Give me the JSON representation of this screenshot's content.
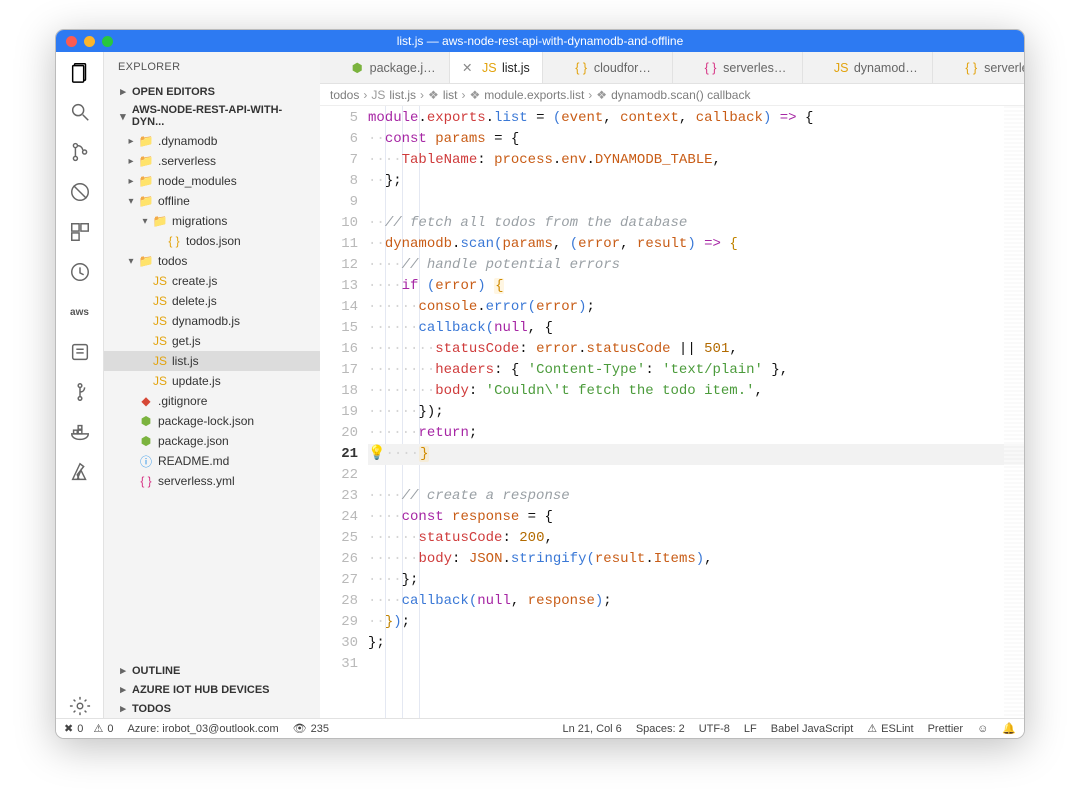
{
  "title": "list.js — aws-node-rest-api-with-dynamodb-and-offline",
  "explorer_label": "EXPLORER",
  "sections": {
    "open_editors": "OPEN EDITORS",
    "project": "AWS-NODE-REST-API-WITH-DYN...",
    "outline": "OUTLINE",
    "azure": "AZURE IOT HUB DEVICES",
    "todos": "TODOS"
  },
  "tree": [
    {
      "i": 0,
      "d": 1,
      "tw": "▸",
      "ic": "folder",
      "cls": "folder",
      "t": ".dynamodb"
    },
    {
      "i": 1,
      "d": 1,
      "tw": "▸",
      "ic": "folder",
      "cls": "folder",
      "t": ".serverless"
    },
    {
      "i": 2,
      "d": 1,
      "tw": "▸",
      "ic": "folder",
      "cls": "folder",
      "t": "node_modules"
    },
    {
      "i": 3,
      "d": 1,
      "tw": "▾",
      "ic": "folder",
      "cls": "fopen",
      "t": "offline"
    },
    {
      "i": 4,
      "d": 2,
      "tw": "▾",
      "ic": "folder",
      "cls": "fopen",
      "t": "migrations"
    },
    {
      "i": 5,
      "d": 3,
      "tw": "",
      "ic": "{ }",
      "cls": "jsonc",
      "t": "todos.json"
    },
    {
      "i": 6,
      "d": 1,
      "tw": "▾",
      "ic": "folder",
      "cls": "fopen",
      "t": "todos"
    },
    {
      "i": 7,
      "d": 2,
      "tw": "",
      "ic": "JS",
      "cls": "js",
      "t": "create.js"
    },
    {
      "i": 8,
      "d": 2,
      "tw": "",
      "ic": "JS",
      "cls": "js",
      "t": "delete.js"
    },
    {
      "i": 9,
      "d": 2,
      "tw": "",
      "ic": "JS",
      "cls": "js",
      "t": "dynamodb.js"
    },
    {
      "i": 10,
      "d": 2,
      "tw": "",
      "ic": "JS",
      "cls": "js",
      "t": "get.js"
    },
    {
      "i": 11,
      "d": 2,
      "tw": "",
      "ic": "JS",
      "cls": "js",
      "t": "list.js",
      "sel": true
    },
    {
      "i": 12,
      "d": 2,
      "tw": "",
      "ic": "JS",
      "cls": "js",
      "t": "update.js"
    },
    {
      "i": 13,
      "d": 1,
      "tw": "",
      "ic": "◆",
      "cls": "gitig",
      "t": ".gitignore"
    },
    {
      "i": 14,
      "d": 1,
      "tw": "",
      "ic": "⬢",
      "cls": "lock",
      "t": "package-lock.json"
    },
    {
      "i": 15,
      "d": 1,
      "tw": "",
      "ic": "⬢",
      "cls": "lock",
      "t": "package.json"
    },
    {
      "i": 16,
      "d": 1,
      "tw": "",
      "ic": "ⓘ",
      "cls": "info",
      "t": "README.md"
    },
    {
      "i": 17,
      "d": 1,
      "tw": "",
      "ic": "{ }",
      "cls": "yml",
      "t": "serverless.yml"
    }
  ],
  "tabs": [
    {
      "i": 0,
      "ic": "⬢",
      "cls": "lock",
      "t": "package.json"
    },
    {
      "i": 1,
      "ic": "JS",
      "cls": "js",
      "t": "list.js",
      "active": true
    },
    {
      "i": 2,
      "ic": "{ }",
      "cls": "jsonc",
      "t": "cloudformati"
    },
    {
      "i": 3,
      "ic": "{ }",
      "cls": "yml",
      "t": "serverless.yr"
    },
    {
      "i": 4,
      "ic": "JS",
      "cls": "js",
      "t": "dynamodb.js"
    },
    {
      "i": 5,
      "ic": "{ }",
      "cls": "jsonc",
      "t": "serverless-s"
    }
  ],
  "breadcrumb": [
    {
      "t": "todos",
      "ic": ""
    },
    {
      "t": "list.js",
      "ic": "JS"
    },
    {
      "t": "list",
      "ic": "❖"
    },
    {
      "t": "module.exports.list",
      "ic": "❖"
    },
    {
      "t": "dynamodb.scan() callback",
      "ic": "❖"
    }
  ],
  "code": {
    "first_line": 5,
    "active_line": 21,
    "lines": [
      {
        "n": 5,
        "h": "<span class='mtk-kw'>module</span><span class='mtk-op'>.</span><span class='mtk-prop'>exports</span><span class='mtk-op'>.</span><span class='mtk-call'>list</span> <span class='mtk-op'>=</span> <span class='mtk-par'>(</span><span class='mtk-var'>event</span><span class='mtk-op'>,</span> <span class='mtk-var'>context</span><span class='mtk-op'>,</span> <span class='mtk-var'>callback</span><span class='mtk-par'>)</span> <span class='mtk-kw'>=&gt;</span> <span class='mtk-op'>{</span>"
      },
      {
        "n": 6,
        "ind": "··",
        "h": "<span class='mtk-kw'>const</span> <span class='mtk-var'>params</span> <span class='mtk-op'>=</span> <span class='mtk-op'>{</span>"
      },
      {
        "n": 7,
        "ind": "····",
        "h": "<span class='mtk-prop'>TableName</span><span class='mtk-op'>:</span> <span class='mtk-var'>process</span><span class='mtk-op'>.</span><span class='mtk-var'>env</span><span class='mtk-op'>.</span><span class='mtk-var'>DYNAMODB_TABLE</span><span class='mtk-op'>,</span>"
      },
      {
        "n": 8,
        "ind": "··",
        "h": "<span class='mtk-op'>};</span>"
      },
      {
        "n": 9,
        "ind": "",
        "h": ""
      },
      {
        "n": 10,
        "ind": "··",
        "h": "<span class='mtk-cm'>// fetch all todos from the database</span>"
      },
      {
        "n": 11,
        "ind": "··",
        "h": "<span class='mtk-var'>dynamodb</span><span class='mtk-op'>.</span><span class='mtk-call'>scan</span><span class='mtk-par'>(</span><span class='mtk-var'>params</span><span class='mtk-op'>,</span> <span class='mtk-par'>(</span><span class='mtk-var'>error</span><span class='mtk-op'>,</span> <span class='mtk-var'>result</span><span class='mtk-par'>)</span> <span class='mtk-kw'>=&gt;</span> <span class='mtk-fn'>{</span>"
      },
      {
        "n": 12,
        "ind": "····",
        "h": "<span class='mtk-cm'>// handle potential errors</span>"
      },
      {
        "n": 13,
        "ind": "····",
        "h": "<span class='mtk-kw'>if</span> <span class='mtk-par'>(</span><span class='mtk-var'>error</span><span class='mtk-par'>)</span> <span class='mtk-sq'>{</span>"
      },
      {
        "n": 14,
        "ind": "······",
        "h": "<span class='mtk-var'>console</span><span class='mtk-op'>.</span><span class='mtk-call'>error</span><span class='mtk-par'>(</span><span class='mtk-var'>error</span><span class='mtk-par'>)</span><span class='mtk-op'>;</span>"
      },
      {
        "n": 15,
        "ind": "······",
        "h": "<span class='mtk-call'>callback</span><span class='mtk-par'>(</span><span class='mtk-kw'>null</span><span class='mtk-op'>,</span> <span class='mtk-op'>{</span>"
      },
      {
        "n": 16,
        "ind": "········",
        "h": "<span class='mtk-prop'>statusCode</span><span class='mtk-op'>:</span> <span class='mtk-var'>error</span><span class='mtk-op'>.</span><span class='mtk-var'>statusCode</span> <span class='mtk-op'>||</span> <span class='mtk-num'>501</span><span class='mtk-op'>,</span>"
      },
      {
        "n": 17,
        "ind": "········",
        "h": "<span class='mtk-prop'>headers</span><span class='mtk-op'>:</span> <span class='mtk-op'>{</span> <span class='mtk-str'>'Content-Type'</span><span class='mtk-op'>:</span> <span class='mtk-str'>'text/plain'</span> <span class='mtk-op'>},</span>"
      },
      {
        "n": 18,
        "ind": "········",
        "h": "<span class='mtk-prop'>body</span><span class='mtk-op'>:</span> <span class='mtk-str'>'Couldn\\'t fetch the todo item.'</span><span class='mtk-op'>,</span>"
      },
      {
        "n": 19,
        "ind": "······",
        "h": "<span class='mtk-op'>});</span>"
      },
      {
        "n": 20,
        "ind": "······",
        "h": "<span class='mtk-kw'>return</span><span class='mtk-op'>;</span>"
      },
      {
        "n": 21,
        "ind": "····",
        "pre": "<span class='mtk-bulb'>💡</span>",
        "h": "<span class='mtk-sq'>}</span>"
      },
      {
        "n": 22,
        "ind": "",
        "h": ""
      },
      {
        "n": 23,
        "ind": "····",
        "h": "<span class='mtk-cm'>// create a response</span>"
      },
      {
        "n": 24,
        "ind": "····",
        "h": "<span class='mtk-kw'>const</span> <span class='mtk-var'>response</span> <span class='mtk-op'>=</span> <span class='mtk-op'>{</span>"
      },
      {
        "n": 25,
        "ind": "······",
        "h": "<span class='mtk-prop'>statusCode</span><span class='mtk-op'>:</span> <span class='mtk-num'>200</span><span class='mtk-op'>,</span>"
      },
      {
        "n": 26,
        "ind": "······",
        "h": "<span class='mtk-prop'>body</span><span class='mtk-op'>:</span> <span class='mtk-var'>JSON</span><span class='mtk-op'>.</span><span class='mtk-call'>stringify</span><span class='mtk-par'>(</span><span class='mtk-var'>result</span><span class='mtk-op'>.</span><span class='mtk-var'>Items</span><span class='mtk-par'>)</span><span class='mtk-op'>,</span>"
      },
      {
        "n": 27,
        "ind": "····",
        "h": "<span class='mtk-op'>};</span>"
      },
      {
        "n": 28,
        "ind": "····",
        "h": "<span class='mtk-call'>callback</span><span class='mtk-par'>(</span><span class='mtk-kw'>null</span><span class='mtk-op'>,</span> <span class='mtk-var'>response</span><span class='mtk-par'>)</span><span class='mtk-op'>;</span>"
      },
      {
        "n": 29,
        "ind": "··",
        "h": "<span class='mtk-fn'>}</span><span class='mtk-par'>)</span><span class='mtk-op'>;</span>"
      },
      {
        "n": 30,
        "ind": "",
        "h": "<span class='mtk-op'>};</span>"
      },
      {
        "n": 31,
        "ind": "",
        "h": ""
      }
    ]
  },
  "status": {
    "errors": "0",
    "warnings": "0",
    "azure": "Azure: irobot_03@outlook.com",
    "eye": "235",
    "lncol": "Ln 21, Col 6",
    "spaces": "Spaces: 2",
    "encoding": "UTF-8",
    "eol": "LF",
    "lang": "Babel JavaScript",
    "eslint": "ESLint",
    "prettier": "Prettier"
  }
}
